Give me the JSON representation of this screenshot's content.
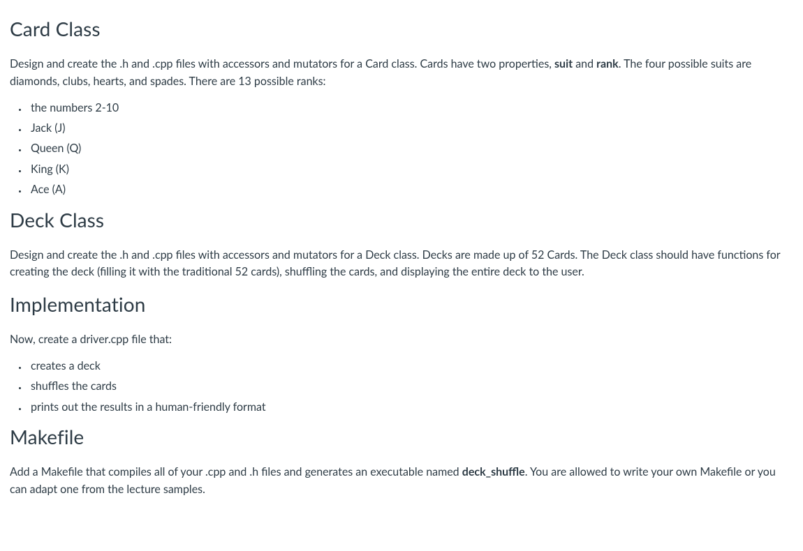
{
  "sections": {
    "card": {
      "heading": "Card Class",
      "intro_pre": "Design and create the .h and .cpp files with accessors and mutators for a Card class. Cards have two properties, ",
      "bold1": "suit",
      "intro_mid": " and ",
      "bold2": "rank",
      "intro_post": ". The four possible suits are diamonds, clubs, hearts, and spades. There are 13 possible ranks:",
      "items": [
        "the numbers 2-10",
        "Jack (J)",
        "Queen (Q)",
        "King (K)",
        "Ace (A)"
      ]
    },
    "deck": {
      "heading": "Deck Class",
      "body": "Design and create the .h and .cpp files with accessors and mutators for a Deck class. Decks are made up of 52 Cards. The Deck class should have functions for creating the deck (filling it with the traditional 52 cards), shuffling the cards, and displaying the entire deck to the user."
    },
    "impl": {
      "heading": "Implementation",
      "intro": "Now, create a driver.cpp file that:",
      "items": [
        "creates a deck",
        "shuffles the cards",
        "prints out the results in a human-friendly format"
      ]
    },
    "makefile": {
      "heading": "Makefile",
      "body_pre": "Add a Makefile that compiles all of your .cpp and .h files and generates an executable named ",
      "bold": "deck_shuffle",
      "body_post": ". You are allowed to write your own Makefile or you can adapt one from the lecture samples."
    }
  }
}
